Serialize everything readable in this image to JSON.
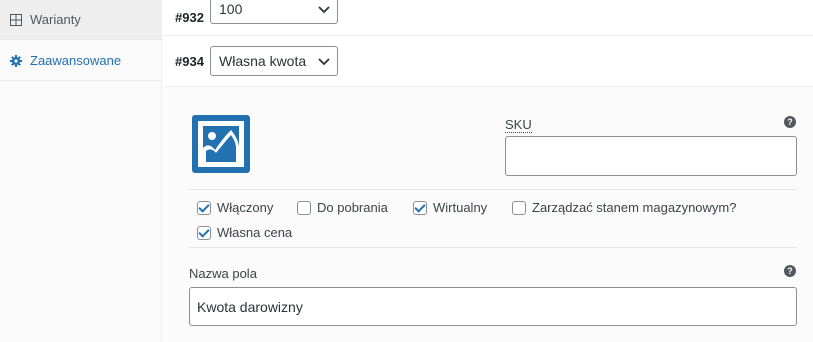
{
  "sidebar": {
    "items": [
      {
        "label": "Warianty",
        "icon": "grid-icon"
      },
      {
        "label": "Zaawansowane",
        "icon": "gear-icon"
      }
    ]
  },
  "variations": [
    {
      "id": "#932",
      "value": "100"
    },
    {
      "id": "#934",
      "value": "Własna kwota"
    }
  ],
  "detail": {
    "sku_label": "SKU",
    "sku_value": "",
    "checkboxes": [
      {
        "label": "Włączony",
        "checked": true
      },
      {
        "label": "Do pobrania",
        "checked": false
      },
      {
        "label": "Wirtualny",
        "checked": true
      },
      {
        "label": "Zarządzać stanem magazynowym?",
        "checked": false
      },
      {
        "label": "Własna cena",
        "checked": true
      }
    ],
    "field_name_label": "Nazwa pola",
    "field_name_value": "Kwota darowizny"
  },
  "colors": {
    "accent": "#2271b1"
  }
}
